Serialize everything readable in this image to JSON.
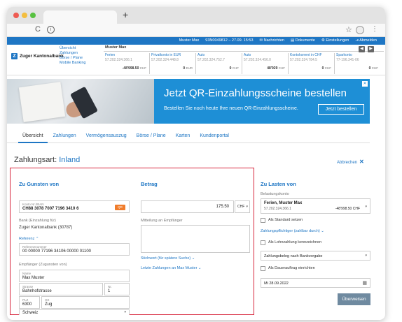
{
  "browser": {
    "tab_title": "",
    "new_tab": "+",
    "reload_icon": "reload-icon",
    "info_icon": "i"
  },
  "header": {
    "user": "Muster Max",
    "session": "93N0049812 – 27.09. 15:53",
    "links": [
      "Nachrichten",
      "Dokumente",
      "Einstellungen",
      "Abmelden"
    ]
  },
  "logo": {
    "name": "Zuger Kantonalbank"
  },
  "sidenav": [
    "Übersicht",
    "Zahlungen",
    "Börse / Plane",
    "Mobile Banking"
  ],
  "accounts": {
    "owner": "Muster Max",
    "items": [
      {
        "name": "Ferien",
        "number": "57.202.324.366.1",
        "amount": "-48'998.50",
        "currency": "CHF"
      },
      {
        "name": "Privatkonto in EUR",
        "number": "57.202.324.448.8",
        "amount": "0",
        "currency": "EUR"
      },
      {
        "name": "Auto",
        "number": "57.202.324.752.7",
        "amount": "0",
        "currency": "CHF"
      },
      {
        "name": "Auto",
        "number": "57.202.324.456.0",
        "amount": "48'929",
        "currency": "CHF"
      },
      {
        "name": "Kontokorrent in CHF",
        "number": "57.202.324.784.5",
        "amount": "0",
        "currency": "CHF"
      },
      {
        "name": "Sparkonto",
        "number": "77-196.341-06",
        "amount": "0",
        "currency": "CHF"
      }
    ]
  },
  "banner": {
    "title": "Jetzt QR-Einzahlungsscheine bestellen",
    "text": "Bestellen Sie noch heute Ihre neuen QR-Einzahlungsscheine.",
    "button": "Jetzt bestellen",
    "close": "✕"
  },
  "tabs": [
    "Übersicht",
    "Zahlungen",
    "Vermögensauszug",
    "Börse / Plane",
    "Karten",
    "Kundenportal"
  ],
  "payment": {
    "title_prefix": "Zahlungsart:",
    "title_value": "Inland",
    "cancel": "Abbrechen",
    "cancel_icon": "✕",
    "favor": {
      "heading": "Zu Gunsten von",
      "iban_label": "Konto Nr./IBAN",
      "iban_value": "CH88 3078 7007 7196 3410 6",
      "qr_badge": "QR",
      "bank_label": "Bank (Einzahlung für)",
      "bank_value": "Zuger Kantonalbank (30787)",
      "reference_link": "Referenz ⌃",
      "reference_label": "Referenznummer",
      "reference_value": "00 00000 77196 34106 00000 01100",
      "recipient_label": "Empfänger (Zugunsten von)",
      "name_label": "Name",
      "name_value": "Max Muster",
      "street_label": "Strasse",
      "street_value": "Bahnhofstrasse",
      "nr_label": "Nr.",
      "nr_value": "1",
      "plz_label": "PLZ",
      "plz_value": "6300",
      "ort_label": "Ort",
      "ort_value": "Zug",
      "country_value": "Schweiz"
    },
    "amount": {
      "heading": "Betrag",
      "value": "175.50",
      "currency": "CHF",
      "message_label": "Mitteilung an Empfänger",
      "keyword_link": "Stichwort (für spätere Suche) ⌄",
      "last_link": "Letzte Zahlungen an Max Muster ⌄"
    },
    "debit": {
      "heading": "Zu Lasten von",
      "account_label": "Belastungskonto",
      "account_name": "Ferien, Muster Max",
      "account_number": "57.202.324.366.1",
      "account_amount": "-48'998.50 CHF",
      "standard_label": "Als Standard setzen",
      "payer_link": "Zahlungspflichtiger (zahlbar durch) ⌄",
      "salary_label": "Als Lohnzahlung kennzeichnen",
      "doc_select": "Zahlungsbeleg nach Bankvorgabe",
      "standing_label": "Als Dauerauftrag einrichten",
      "date_value": "Mi  28.09.2022",
      "submit": "Überweisen"
    }
  }
}
